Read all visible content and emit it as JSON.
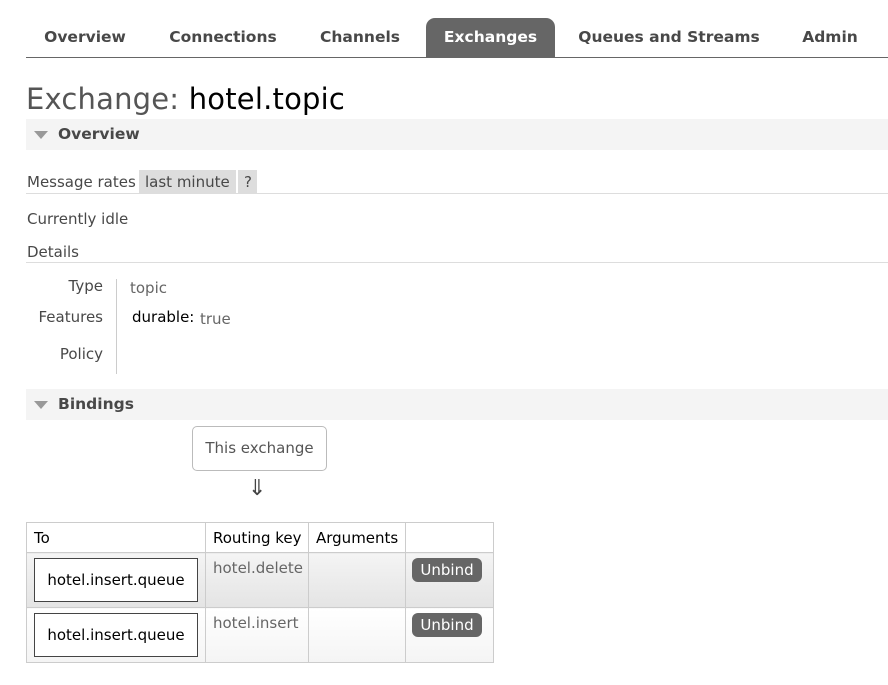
{
  "nav": {
    "tabs": [
      {
        "label": "Overview"
      },
      {
        "label": "Connections"
      },
      {
        "label": "Channels"
      },
      {
        "label": "Exchanges",
        "active": true
      },
      {
        "label": "Queues and Streams"
      },
      {
        "label": "Admin"
      }
    ]
  },
  "page": {
    "title_prefix": "Exchange:",
    "title_name": "hotel.topic"
  },
  "overview": {
    "header": "Overview",
    "message_rates_label": "Message rates",
    "rate_period": "last minute",
    "help": "?",
    "status": "Currently idle",
    "details_label": "Details",
    "type_label": "Type",
    "type_value": "topic",
    "features_label": "Features",
    "feature_key": "durable:",
    "feature_value": "true",
    "policy_label": "Policy"
  },
  "bindings": {
    "header": "Bindings",
    "source": "This exchange",
    "arrow": "⇓",
    "columns": [
      "To",
      "Routing key",
      "Arguments",
      ""
    ],
    "rows": [
      {
        "to": "hotel.insert.queue",
        "routing_key": "hotel.delete",
        "arguments": "",
        "action": "Unbind"
      },
      {
        "to": "hotel.insert.queue",
        "routing_key": "hotel.insert",
        "arguments": "",
        "action": "Unbind"
      }
    ]
  },
  "colors": {
    "tab_active_bg": "#666666",
    "section_bg": "#f4f4f4",
    "button_bg": "#666666"
  }
}
